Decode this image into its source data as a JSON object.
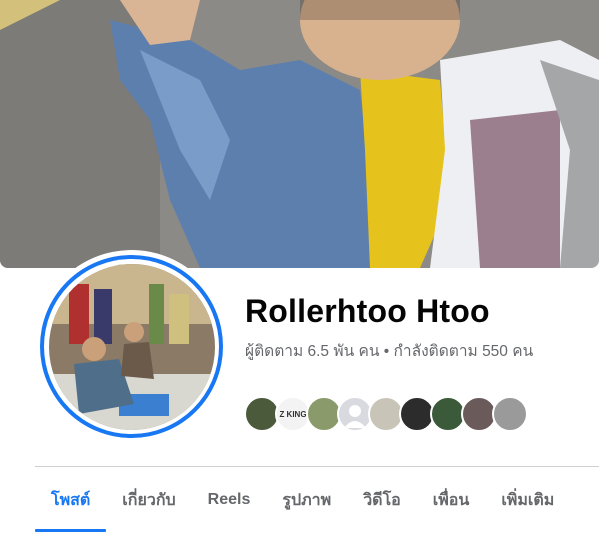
{
  "profile": {
    "name": "Rollerhtoo Htoo",
    "stats_line": "ผู้ติดตาม 6.5 พัน คน • กำลังติดตาม 550 คน",
    "followers": "6.5 พัน",
    "following": "550"
  },
  "friends": [
    {
      "label": "",
      "color": "#4a5a3a"
    },
    {
      "label": "Z KING",
      "color": "#f3f3f3"
    },
    {
      "label": "",
      "color": "#8a9a6a"
    },
    {
      "label": "",
      "color": "#d8dadf"
    },
    {
      "label": "",
      "color": "#c9c4b8"
    },
    {
      "label": "",
      "color": "#2c2c2c"
    },
    {
      "label": "",
      "color": "#3a5a3a"
    },
    {
      "label": "",
      "color": "#6a5a5a"
    },
    {
      "label": "",
      "color": "#9a9a9a"
    }
  ],
  "tabs": [
    {
      "label": "โพสต์",
      "active": true
    },
    {
      "label": "เกี่ยวกับ",
      "active": false
    },
    {
      "label": "Reels",
      "active": false
    },
    {
      "label": "รูปภาพ",
      "active": false
    },
    {
      "label": "วิดีโอ",
      "active": false
    },
    {
      "label": "เพื่อน",
      "active": false
    },
    {
      "label": "เพิ่มเติม",
      "active": false
    }
  ],
  "colors": {
    "accent": "#1877f2",
    "text": "#050505",
    "muted": "#65676b"
  }
}
